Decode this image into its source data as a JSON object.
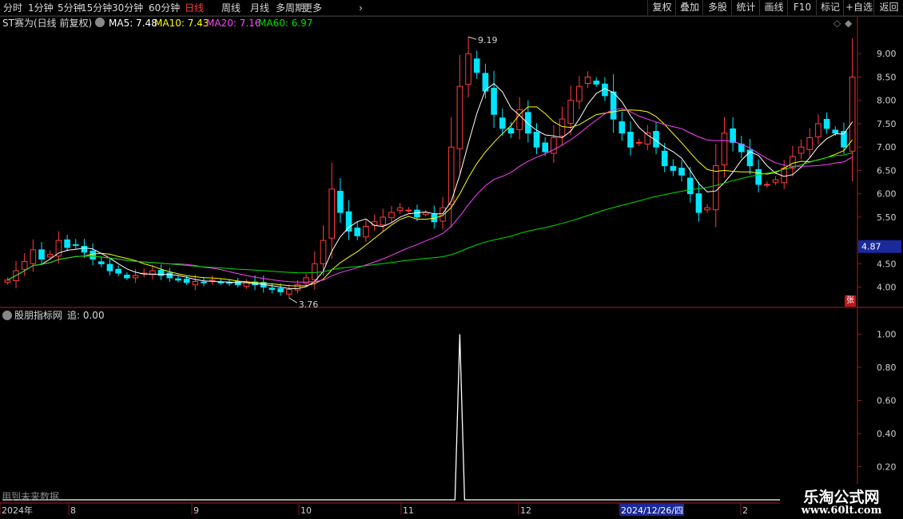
{
  "toolbar": {
    "periods": [
      "分时",
      "1分钟",
      "5分钟",
      "15分钟",
      "30分钟",
      "60分钟",
      "日线",
      "周线",
      "月线",
      "多周期",
      "更多"
    ],
    "active_period": "日线",
    "right_buttons": [
      "复权",
      "叠加",
      "多股",
      "统计",
      "画线",
      "F10",
      "标记",
      "+自选",
      "返回"
    ]
  },
  "title": {
    "stock": "ST赛为(日线 前复权)",
    "ma5": "MA5: 7.48",
    "ma10": "MA10: 7.43",
    "ma20": "MA20: 7.16",
    "ma60": "MA60: 6.97"
  },
  "indicator": {
    "title": "股朋指标网",
    "value": "追: 0.00",
    "note": "用到未来数据"
  },
  "price_axis": {
    "ticks": [
      "9.00",
      "8.50",
      "8.00",
      "7.50",
      "7.00",
      "6.50",
      "6.00",
      "5.50",
      "4.50",
      "4.00"
    ],
    "current_price": "4.87",
    "high_label": "9.19",
    "low_label": "3.76",
    "ylim": [
      3.6,
      9.5
    ]
  },
  "indicator_axis": {
    "ticks": [
      "1.00",
      "0.80",
      "0.60",
      "0.40",
      "0.20"
    ],
    "ylim": [
      0,
      1.07
    ]
  },
  "date_axis": [
    "2024年",
    "8",
    "9",
    "10",
    "11",
    "12",
    "2024/12/26/四",
    "2"
  ],
  "zhang_mark": "张",
  "logo": {
    "cn": "乐淘公式网",
    "url": "www.60lt.com"
  },
  "colors": {
    "up": "#ff3b3b",
    "down": "#00e5ff",
    "ma5": "#ffffff",
    "ma10": "#ffff00",
    "ma20": "#ff40ff",
    "ma60": "#00e000",
    "grid": "#8b1a1a"
  },
  "chart_data": {
    "type": "candlestick",
    "close": [
      4.15,
      4.35,
      4.55,
      4.8,
      4.6,
      4.7,
      5.0,
      4.85,
      4.9,
      4.75,
      4.6,
      4.5,
      4.35,
      4.3,
      4.2,
      4.25,
      4.3,
      4.35,
      4.25,
      4.2,
      4.15,
      4.1,
      4.12,
      4.1,
      4.15,
      4.1,
      4.08,
      4.05,
      4.1,
      4.05,
      4.0,
      3.95,
      3.9,
      3.95,
      4.05,
      4.2,
      4.5,
      5.0,
      6.1,
      5.6,
      5.2,
      5.1,
      5.3,
      5.4,
      5.5,
      5.6,
      5.7,
      5.65,
      5.5,
      5.6,
      5.4,
      5.7,
      7.0,
      8.3,
      9.0,
      8.6,
      8.2,
      7.7,
      7.4,
      7.3,
      7.8,
      7.3,
      7.0,
      6.9,
      7.2,
      7.6,
      8.0,
      8.3,
      8.5,
      8.35,
      8.1,
      7.6,
      7.3,
      7.0,
      7.1,
      7.3,
      7.0,
      6.6,
      6.5,
      6.4,
      6.0,
      5.6,
      5.7,
      6.6,
      7.3,
      7.1,
      6.9,
      6.6,
      6.2,
      6.2,
      6.3,
      6.55,
      6.8,
      7.0,
      7.2,
      7.5,
      7.4,
      7.3,
      7.0,
      8.5
    ],
    "ma_last": {
      "MA5": 7.48,
      "MA10": 7.43,
      "MA20": 7.16,
      "MA60": 6.97
    },
    "indicator_series": {
      "name": "追",
      "spike_index": 53,
      "spike_value": 1.0,
      "baseline": 0.0
    }
  }
}
